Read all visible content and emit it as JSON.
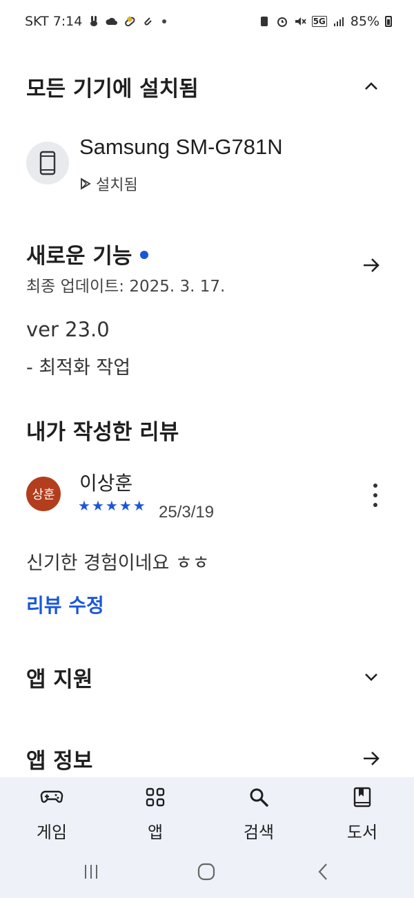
{
  "status_bar": {
    "carrier_time": "SKT 7:14",
    "network": "5G",
    "battery": "85%"
  },
  "installed_section": {
    "title": "모든 기기에 설치됨",
    "toggle_icon": "chevron-up-icon",
    "device": {
      "name": "Samsung SM-G781N",
      "status": "설치됨",
      "icon": "phone-icon"
    }
  },
  "whats_new": {
    "title": "새로운 기능",
    "last_updated": "최종 업데이트: 2025. 3. 17.",
    "version": "ver 23.0",
    "note": "- 최적화 작업",
    "accent_color": "#1a56db"
  },
  "my_review": {
    "title": "내가 작성한 리뷰",
    "avatar_text": "상훈",
    "avatar_color": "#b23e1d",
    "reviewer_name": "이상훈",
    "rating": 5,
    "date": "25/3/19",
    "text": "신기한 경험이네요 ㅎㅎ",
    "edit_label": "리뷰 수정"
  },
  "app_support": {
    "title": "앱 지원",
    "icon": "chevron-down-icon"
  },
  "app_info": {
    "title": "앱 정보",
    "icon": "arrow-right-icon"
  },
  "bottom_nav": {
    "items": [
      {
        "label": "게임",
        "icon": "gamepad-icon"
      },
      {
        "label": "앱",
        "icon": "apps-grid-icon"
      },
      {
        "label": "검색",
        "icon": "search-icon"
      },
      {
        "label": "도서",
        "icon": "book-icon"
      }
    ]
  }
}
